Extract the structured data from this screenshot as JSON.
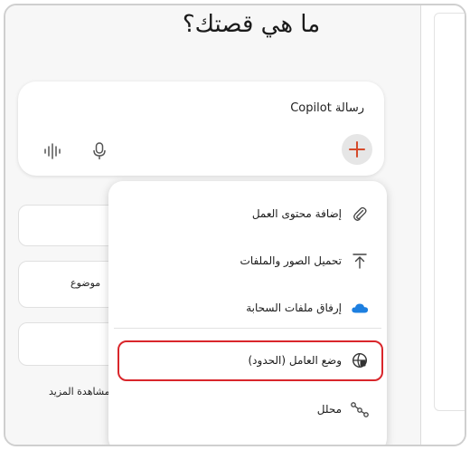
{
  "heading": "ما هي قصتك؟",
  "prompt": {
    "placeholder": "رسالة Copilot",
    "plus_label": "+",
    "mic_icon": "mic-icon",
    "voice_icon": "voice-waveform-icon"
  },
  "background": {
    "topic_label": "موضوع",
    "see_more_label": "مشاهدة المزيد"
  },
  "menu": {
    "items": [
      {
        "label": "إضافة محتوى العمل",
        "icon": "paperclip-icon"
      },
      {
        "label": "تحميل الصور والملفات",
        "icon": "upload-icon"
      },
      {
        "label": "إرفاق ملفات السحابة",
        "icon": "cloud-icon"
      },
      {
        "label": "وضع العامل (الحدود)",
        "icon": "agent-mode-icon",
        "highlighted": true
      },
      {
        "label": "محلل",
        "icon": "analyst-icon"
      }
    ]
  },
  "colors": {
    "highlight_border": "#d9262b",
    "cloud_blue": "#1d7fe0",
    "plus_orange": "#d54a2b"
  }
}
